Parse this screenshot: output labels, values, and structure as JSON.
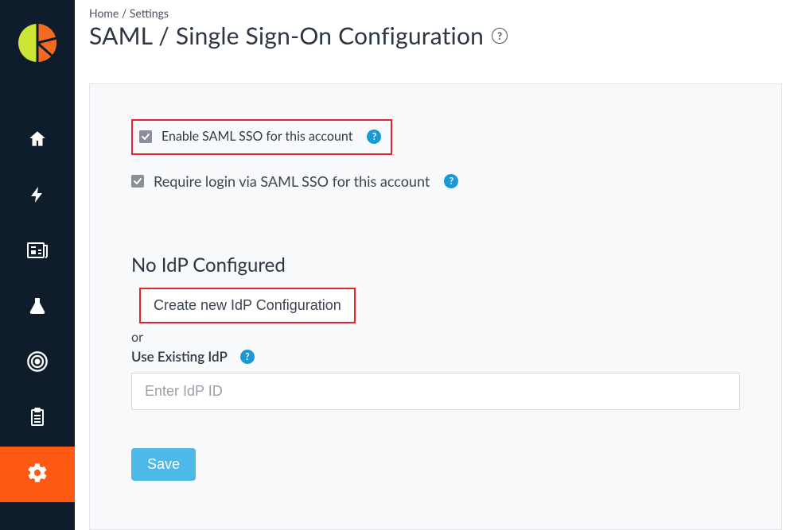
{
  "breadcrumb": {
    "home": "Home",
    "settings": "Settings"
  },
  "page_title": "SAML / Single Sign-On Configuration",
  "options": {
    "enable_label": "Enable SAML SSO for this account",
    "enable_checked": true,
    "require_label": "Require login via SAML SSO for this account",
    "require_checked": true
  },
  "idp": {
    "heading": "No IdP Configured",
    "create_label": "Create new IdP Configuration",
    "or_text": "or",
    "existing_label": "Use Existing IdP",
    "input_placeholder": "Enter IdP ID",
    "input_value": ""
  },
  "buttons": {
    "save": "Save"
  },
  "icons": {
    "help_gray_glyph": "?",
    "help_blue_glyph": "?"
  },
  "colors": {
    "sidebar_bg": "#0e1c2b",
    "accent_orange": "#ff5a14",
    "brand_green": "#cce537",
    "brand_orange": "#f56a1f",
    "highlight_red": "#e3242f",
    "help_blue": "#1999d6",
    "save_blue": "#4cb9e8"
  }
}
